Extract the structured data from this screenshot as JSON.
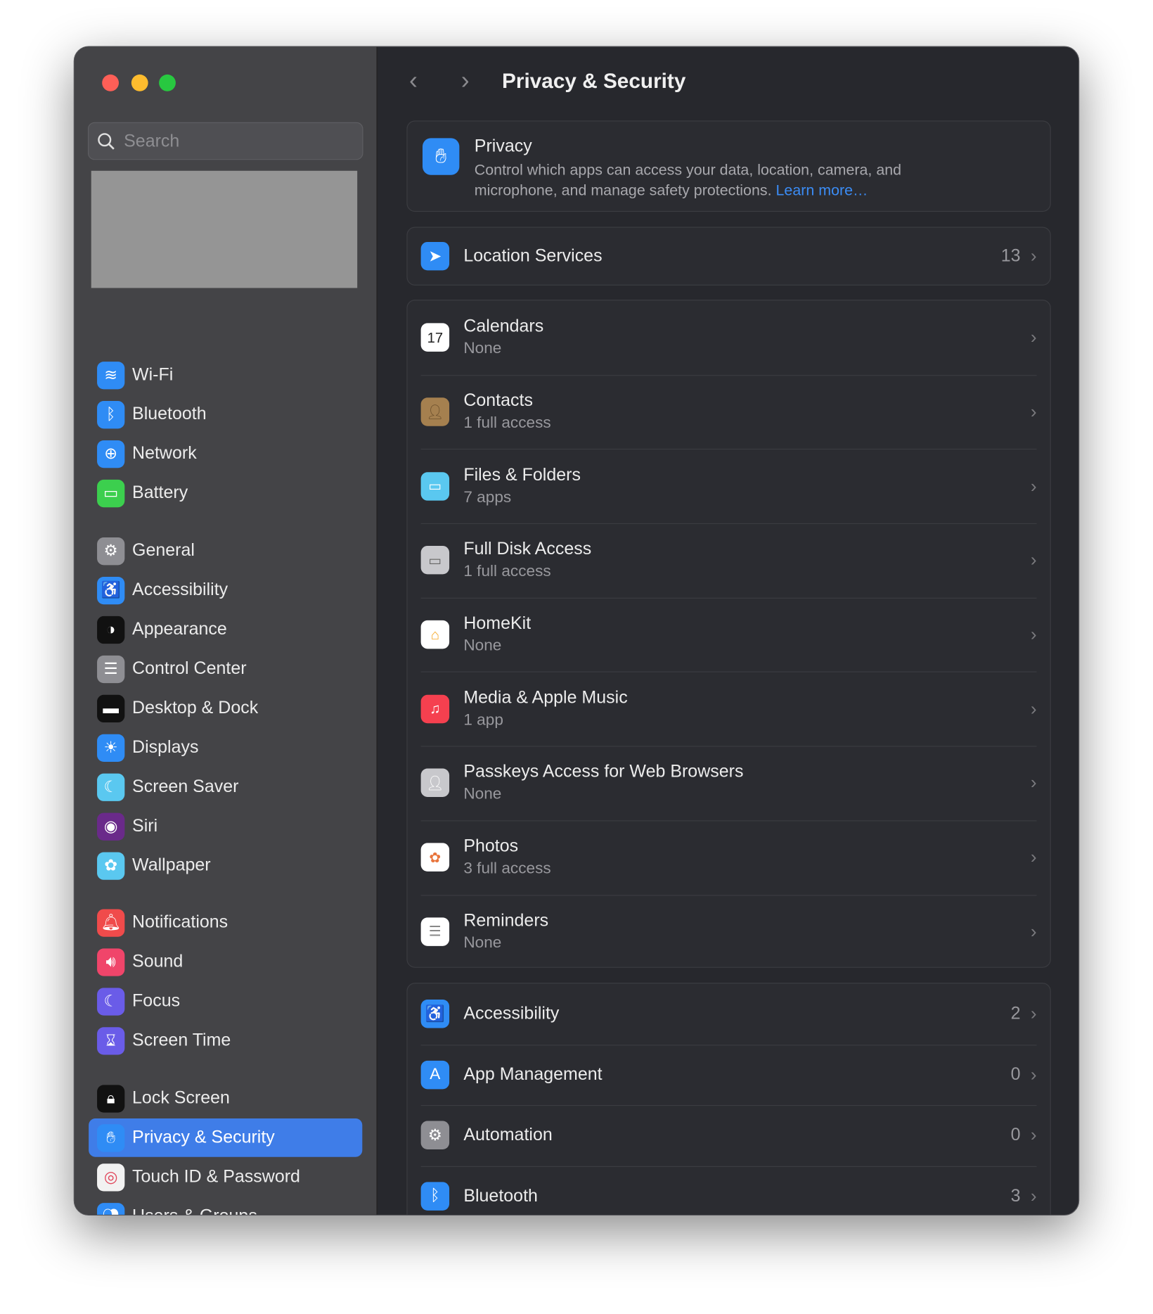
{
  "window": {
    "traffic_lights": {
      "close": "#fe5f57",
      "minimize": "#febc2e",
      "zoom": "#28c840"
    }
  },
  "sidebar": {
    "search": {
      "placeholder": "Search",
      "icon": "magnifying-glass-icon"
    },
    "items": [
      {
        "label": "Wi-Fi",
        "icon": "wifi-icon",
        "color": "#2f8cf5",
        "glyph": "≋"
      },
      {
        "label": "Bluetooth",
        "icon": "bluetooth-icon",
        "color": "#2f8cf5",
        "glyph": "ᛒ"
      },
      {
        "label": "Network",
        "icon": "globe-icon",
        "color": "#2f8cf5",
        "glyph": "⊕"
      },
      {
        "label": "Battery",
        "icon": "battery-icon",
        "color": "#3ccf4e",
        "glyph": "▭"
      },
      {
        "label": "General",
        "icon": "gear-icon",
        "color": "#8e8e93",
        "glyph": "⚙"
      },
      {
        "label": "Accessibility",
        "icon": "accessibility-icon",
        "color": "#2f8cf5",
        "glyph": "♿"
      },
      {
        "label": "Appearance",
        "icon": "appearance-icon",
        "color": "#111111",
        "glyph": "◑"
      },
      {
        "label": "Control Center",
        "icon": "toggles-icon",
        "color": "#8e8e93",
        "glyph": "☰"
      },
      {
        "label": "Desktop & Dock",
        "icon": "dock-icon",
        "color": "#111111",
        "glyph": "▬"
      },
      {
        "label": "Displays",
        "icon": "sun-icon",
        "color": "#2f8cf5",
        "glyph": "☀"
      },
      {
        "label": "Screen Saver",
        "icon": "screen-saver-icon",
        "color": "#5ac8f0",
        "glyph": "☾"
      },
      {
        "label": "Siri",
        "icon": "siri-icon",
        "color": "#6a2a8a",
        "glyph": "◉"
      },
      {
        "label": "Wallpaper",
        "icon": "flower-icon",
        "color": "#5ac8f0",
        "glyph": "✿"
      },
      {
        "label": "Notifications",
        "icon": "bell-icon",
        "color": "#f04b4b",
        "glyph": "🔔︎"
      },
      {
        "label": "Sound",
        "icon": "speaker-icon",
        "color": "#f0456a",
        "glyph": "🔊︎"
      },
      {
        "label": "Focus",
        "icon": "moon-icon",
        "color": "#6a5ce8",
        "glyph": "☾"
      },
      {
        "label": "Screen Time",
        "icon": "hourglass-icon",
        "color": "#6a5ce8",
        "glyph": "⌛︎"
      },
      {
        "label": "Lock Screen",
        "icon": "lock-icon",
        "color": "#111111",
        "glyph": "🔒︎"
      },
      {
        "label": "Privacy & Security",
        "icon": "hand-icon",
        "color": "#2f8cf5",
        "glyph": "✋︎",
        "selected": true
      },
      {
        "label": "Touch ID & Password",
        "icon": "fingerprint-icon",
        "color": "#f2f2f2",
        "glyph": "◎"
      },
      {
        "label": "Users & Groups",
        "icon": "users-icon",
        "color": "#2f8cf5",
        "glyph": "👥︎"
      }
    ]
  },
  "header": {
    "title": "Privacy & Security",
    "back": "‹",
    "forward": "›"
  },
  "privacy": {
    "title": "Privacy",
    "description": "Control which apps can access your data, location, camera, and microphone, and manage safety protections.",
    "link": "Learn more…",
    "icon": "hand-icon"
  },
  "location": {
    "label": "Location Services",
    "count": "13",
    "icon": "location-arrow-icon"
  },
  "permissions": [
    {
      "label": "Calendars",
      "status": "None",
      "icon": "calendar-icon",
      "color": "#ffffff",
      "glyph": "17",
      "fg": "#222"
    },
    {
      "label": "Contacts",
      "status": "1 full access",
      "icon": "contacts-icon",
      "color": "#a5804f",
      "glyph": "👤︎",
      "fg": "#6b4f2c"
    },
    {
      "label": "Files & Folders",
      "status": "7 apps",
      "icon": "folder-icon",
      "color": "#5ac8f0",
      "glyph": "▭",
      "fg": "#fff"
    },
    {
      "label": "Full Disk Access",
      "status": "1 full access",
      "icon": "disk-icon",
      "color": "#c8c8cc",
      "glyph": "▭",
      "fg": "#666"
    },
    {
      "label": "HomeKit",
      "status": "None",
      "icon": "home-icon",
      "color": "#ffffff",
      "glyph": "⌂",
      "fg": "#f5a623"
    },
    {
      "label": "Media & Apple Music",
      "status": "1 app",
      "icon": "music-icon",
      "color": "#f5404f",
      "glyph": "♫",
      "fg": "#fff"
    },
    {
      "label": "Passkeys Access for Web Browsers",
      "status": "None",
      "icon": "passkey-icon",
      "color": "#c8c8cc",
      "glyph": "👤︎",
      "fg": "#fff"
    },
    {
      "label": "Photos",
      "status": "3 full access",
      "icon": "photos-icon",
      "color": "#ffffff",
      "glyph": "✿",
      "fg": "#e8743b"
    },
    {
      "label": "Reminders",
      "status": "None",
      "icon": "reminders-icon",
      "color": "#ffffff",
      "glyph": "☰",
      "fg": "#888"
    }
  ],
  "more": [
    {
      "label": "Accessibility",
      "count": "2",
      "icon": "accessibility-icon",
      "color": "#2f8cf5",
      "glyph": "♿"
    },
    {
      "label": "App Management",
      "count": "0",
      "icon": "app-store-icon",
      "color": "#2f8cf5",
      "glyph": "A"
    },
    {
      "label": "Automation",
      "count": "0",
      "icon": "gears-icon",
      "color": "#8e8e93",
      "glyph": "⚙"
    },
    {
      "label": "Bluetooth",
      "count": "3",
      "icon": "bluetooth-icon",
      "color": "#2f8cf5",
      "glyph": "ᛒ"
    }
  ],
  "colors": {
    "accent": "#3f7de8",
    "link": "#3b8cf5"
  }
}
